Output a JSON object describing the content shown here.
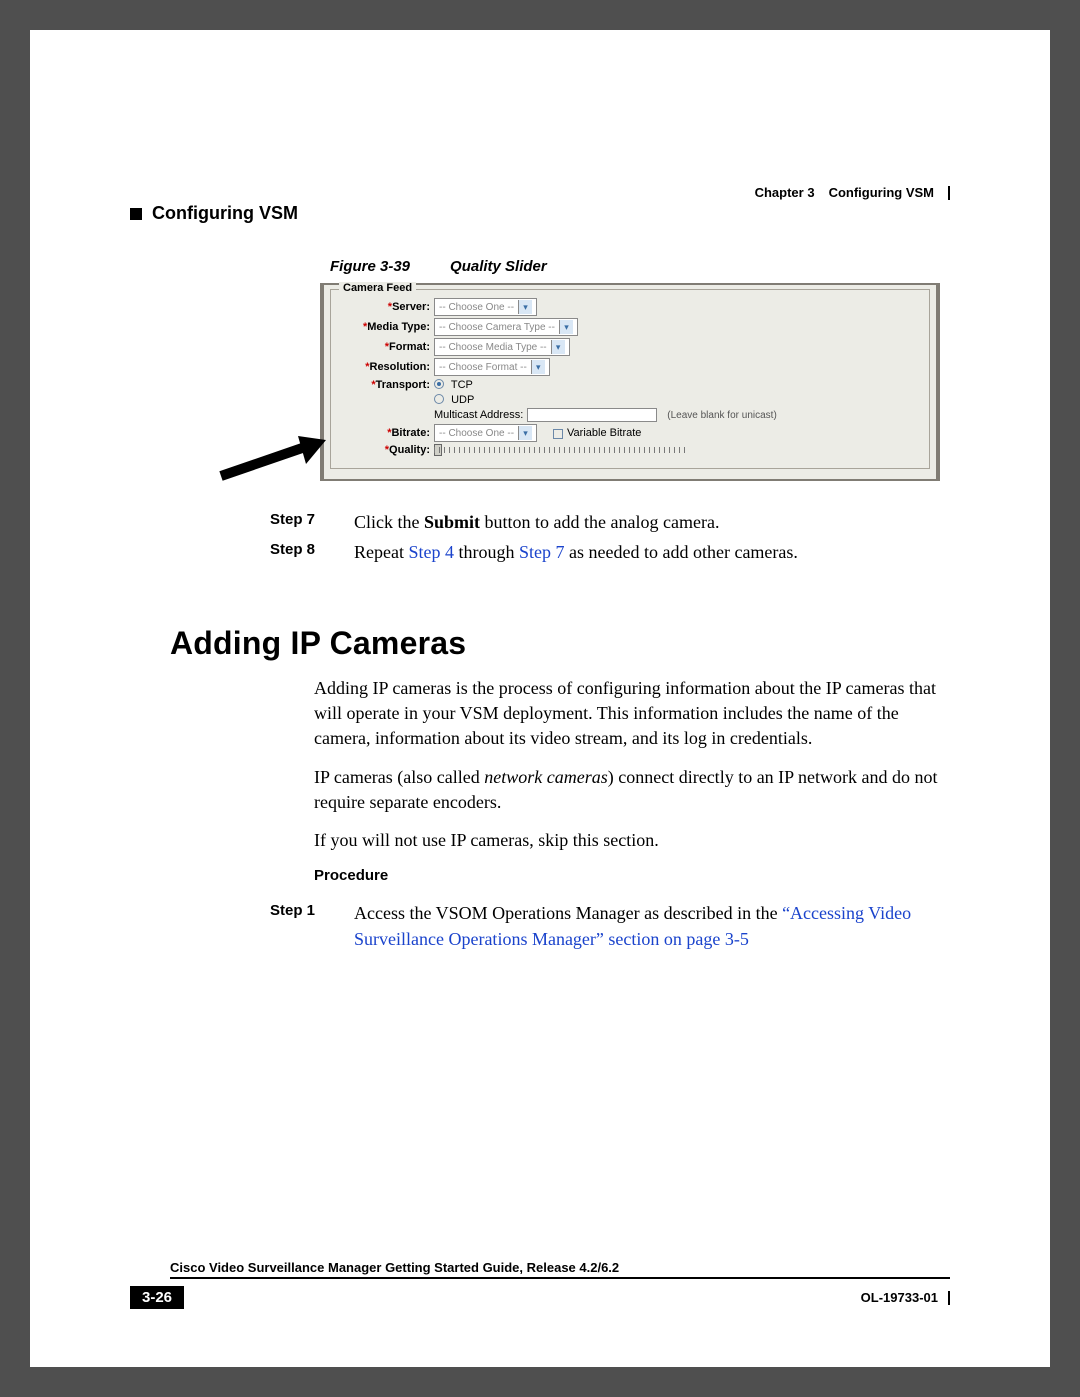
{
  "header": {
    "chapter_label": "Chapter 3",
    "chapter_title": "Configuring VSM",
    "running_head": "Configuring VSM"
  },
  "figure": {
    "label": "Figure 3-39",
    "title": "Quality Slider",
    "fieldset": "Camera Feed",
    "labels": {
      "server": "Server:",
      "media_type": "Media Type:",
      "format": "Format:",
      "resolution": "Resolution:",
      "transport": "Transport:",
      "bitrate": "Bitrate:",
      "quality": "Quality:"
    },
    "selects": {
      "server": "-- Choose One --",
      "media_type": "-- Choose Camera Type --",
      "format": "-- Choose Media Type --",
      "resolution": "-- Choose Format --",
      "bitrate": "-- Choose One --"
    },
    "transport": {
      "tcp": "TCP",
      "udp": "UDP",
      "mcast_label": "Multicast Address:",
      "mcast_hint": "(Leave blank for unicast)"
    },
    "variable_bitrate": "Variable Bitrate"
  },
  "steps_a": [
    {
      "label": "Step 7",
      "pre": "Click the ",
      "bold": "Submit",
      "post": " button to add the analog camera."
    },
    {
      "label": "Step 8",
      "pre": "Repeat ",
      "link1": "Step 4",
      "mid": " through ",
      "link2": "Step 7",
      "post": " as needed to add other cameras."
    }
  ],
  "section": {
    "heading": "Adding IP Cameras",
    "p1": "Adding IP cameras is the process of configuring information about the IP cameras that will operate in your VSM deployment. This information includes the name of the camera, information about its video stream, and its log in credentials.",
    "p2_pre": "IP cameras (also called ",
    "p2_ital": "network cameras",
    "p2_post": ") connect directly to an IP network and do not require separate encoders.",
    "p3": "If you will not use IP cameras, skip this section.",
    "procedure": "Procedure"
  },
  "steps_b": [
    {
      "label": "Step 1",
      "pre": "Access the VSOM Operations Manager as described in the ",
      "link": "“Accessing Video Surveillance Operations Manager” section on page 3-5"
    }
  ],
  "footer": {
    "doc_title": "Cisco Video Surveillance Manager Getting Started Guide, Release 4.2/6.2",
    "page": "3-26",
    "docnum": "OL-19733-01"
  }
}
